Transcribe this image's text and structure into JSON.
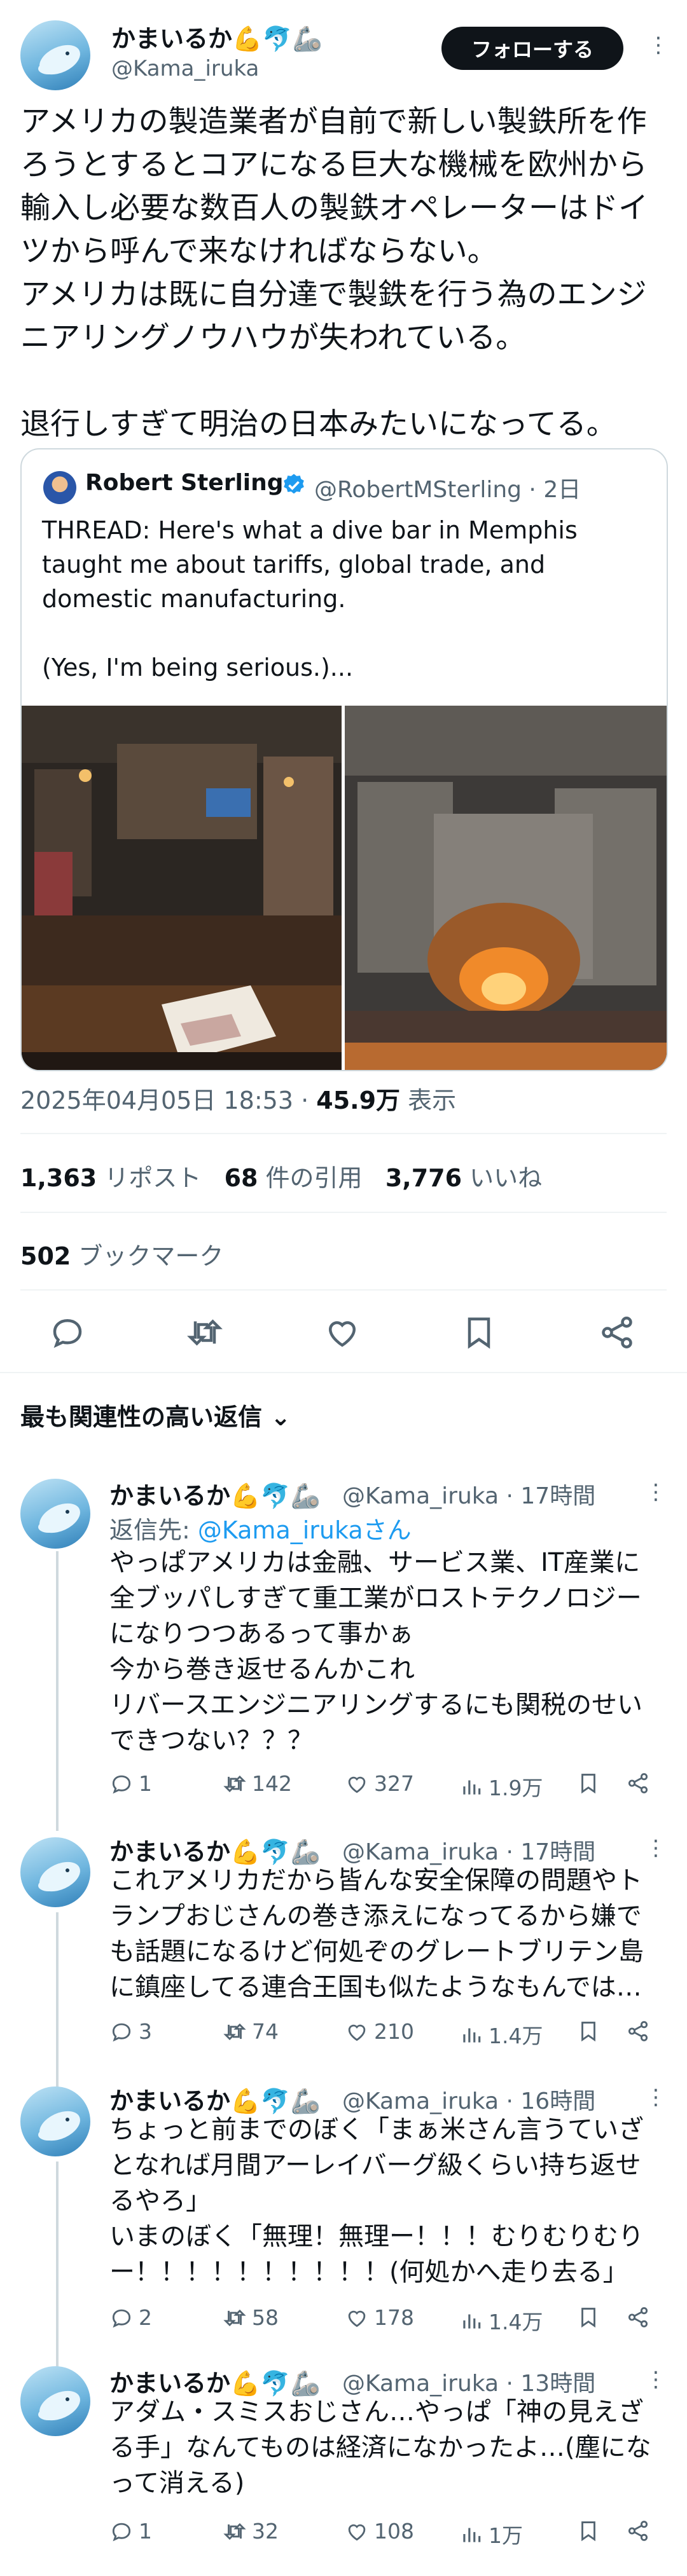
{
  "author": {
    "display_name": "かまいるか💪🐬🦾",
    "handle": "@Kama_iruka",
    "follow_label": "フォローする",
    "more_label": "⋮"
  },
  "tweet": {
    "text": "アメリカの製造業者が自前で新しい製鉄所を作ろうとするとコアになる巨大な機械を欧州から輸入し必要な数百人の製鉄オペレーターはドイツから呼んで来なければならない。\nアメリカは既に自分達で製鉄を行う為のエンジニアリングノウハウが失われている。\n\n退行しすぎて明治の日本みたいになってる。",
    "timestamp": "2025年04月05日 18:53",
    "views_value": "45.9万",
    "views_label": "表示"
  },
  "quote": {
    "name": "Robert Sterling",
    "handle_time": "@RobertMSterling · 2日",
    "text": "THREAD: Here's what a dive bar in Memphis\ntaught me about tariffs, global trade, and\ndomestic manufacturing.\n\n(Yes, I'm being serious.)..."
  },
  "stats": {
    "reposts_value": "1,363",
    "reposts_label": "リポスト",
    "quotes_value": "68",
    "quotes_label": "件の引用",
    "likes_value": "3,776",
    "likes_label": "いいね",
    "bookmarks_value": "502",
    "bookmarks_label": "ブックマーク"
  },
  "sort_label": "最も関連性の高い返信 ⌄",
  "replies": [
    {
      "name": "かまいるか💪🐬🦾",
      "handle_time": "@Kama_iruka · 17時間",
      "reply_to_prefix": "返信先: ",
      "reply_to": "@Kama_irukaさん",
      "text": "やっぱアメリカは金融、サービス業、IT産業に\n全ブッパしすぎて重工業がロストテクノロジー\nになりつつあるって事かぁ\n今から巻き返せるんかこれ\nリバースエンジニアリングするにも関税のせい\nできつない？？？",
      "replies": "1",
      "reposts": "142",
      "likes": "327",
      "views": "1.9万"
    },
    {
      "name": "かまいるか💪🐬🦾",
      "handle_time": "@Kama_iruka · 17時間",
      "text": "これアメリカだから皆んな安全保障の問題やト\nランプおじさんの巻き添えになってるから嫌で\nも話題になるけど何処ぞのグレートブリテン島\nに鎮座してる連合王国も似たようなもんでは…",
      "replies": "3",
      "reposts": "74",
      "likes": "210",
      "views": "1.4万"
    },
    {
      "name": "かまいるか💪🐬🦾",
      "handle_time": "@Kama_iruka · 16時間",
      "text": "ちょっと前までのぼく「まぁ米さん言うていざ\nとなれば月間アーレイバーグ級くらい持ち返せ\nるやろ」\nいまのぼく「無理！無理ー！！！むりむりむり\nー！！！！！！！！！！(何処かへ走り去る」",
      "replies": "2",
      "reposts": "58",
      "likes": "178",
      "views": "1.4万"
    },
    {
      "name": "かまいるか💪🐬🦾",
      "handle_time": "@Kama_iruka · 13時間",
      "text": "アダム・スミスおじさん…やっぱ「神の見えざ\nる手」なんてものは経済になかったよ…(塵にな\nって消える)",
      "replies": "1",
      "reposts": "32",
      "likes": "108",
      "views": "1万"
    }
  ],
  "colors": {
    "accent": "#1d9bf0",
    "text": "#0f1419",
    "muted": "#536471",
    "border": "#eff3f4"
  }
}
